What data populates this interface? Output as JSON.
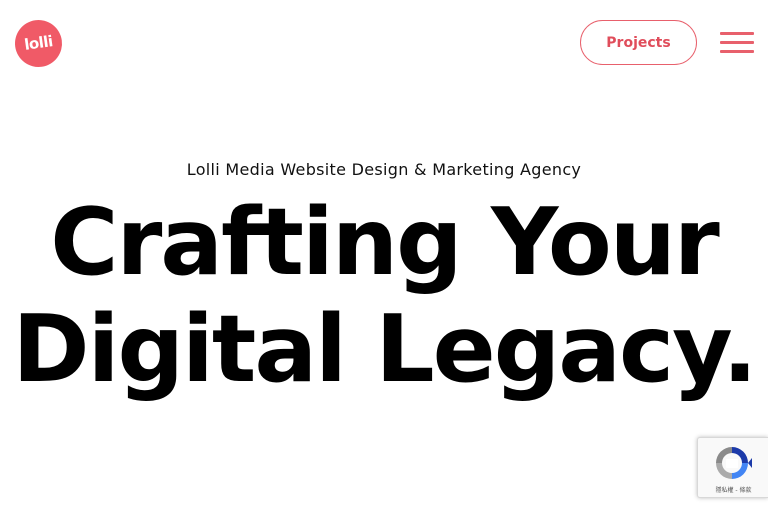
{
  "header": {
    "logo_text": "lolli",
    "projects_label": "Projects"
  },
  "hero": {
    "tagline": "Lolli Media Website Design & Marketing Agency",
    "headline_line1": "Crafting Your",
    "headline_line2": "Digital Legacy."
  },
  "recaptcha": {
    "privacy_label": "隱私權",
    "separator": " - ",
    "terms_label": "條款"
  },
  "icons": {
    "logo": "lolli-logo-icon",
    "menu": "hamburger-menu-icon",
    "recaptcha": "recaptcha-icon"
  },
  "colors": {
    "brand_coral": "#f05a67",
    "button_text": "#e04d5b",
    "menu_bars": "#e8606c",
    "headline": "#000000",
    "background": "#ffffff"
  }
}
